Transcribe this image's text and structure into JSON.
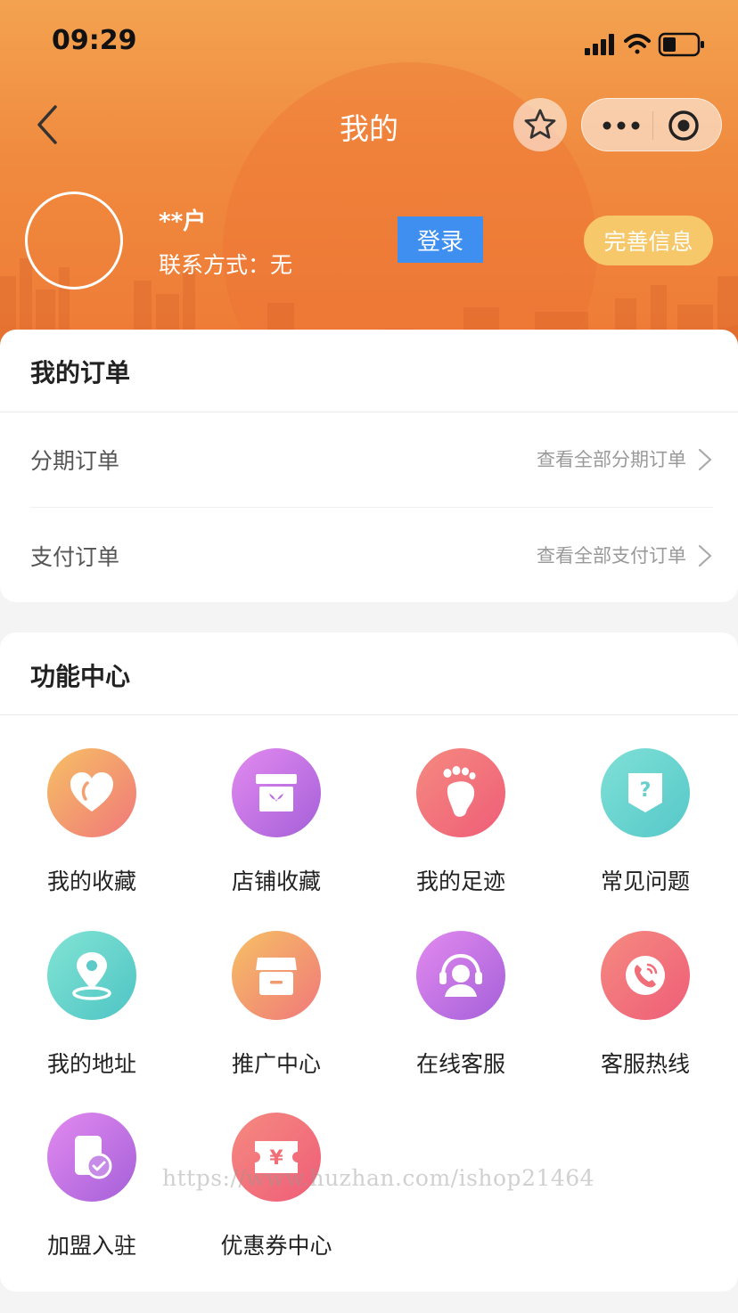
{
  "status_bar": {
    "time": "09:29",
    "icons": [
      "signal-icon",
      "wifi-icon",
      "battery-icon"
    ]
  },
  "nav": {
    "title": "我的",
    "back_icon": "chevron-left-icon",
    "star_icon": "star-icon",
    "menu_icon": "more-dots-icon",
    "close_icon": "target-icon"
  },
  "profile": {
    "name": "**户",
    "contact": "联系方式：无",
    "login_label": "登录",
    "complete_label": "完善信息"
  },
  "orders": {
    "title": "我的订单",
    "rows": [
      {
        "label": "分期订单",
        "link": "查看全部分期订单"
      },
      {
        "label": "支付订单",
        "link": "查看全部支付订单"
      }
    ]
  },
  "functions": {
    "title": "功能中心",
    "items": [
      {
        "label": "我的收藏",
        "icon": "heart-icon"
      },
      {
        "label": "店铺收藏",
        "icon": "box-icon"
      },
      {
        "label": "我的足迹",
        "icon": "footprint-icon"
      },
      {
        "label": "常见问题",
        "icon": "question-icon"
      },
      {
        "label": "我的地址",
        "icon": "location-icon"
      },
      {
        "label": "推广中心",
        "icon": "shop-icon"
      },
      {
        "label": "在线客服",
        "icon": "headset-icon"
      },
      {
        "label": "客服热线",
        "icon": "phone-icon"
      },
      {
        "label": "加盟入驻",
        "icon": "join-icon"
      },
      {
        "label": "优惠券中心",
        "icon": "coupon-icon"
      }
    ]
  },
  "colors": {
    "header_orange": "#f08a3e",
    "login_blue": "#3e8ff0",
    "complete_yellow": "#f6c86a"
  },
  "watermark": "https://www.huzhan.com/ishop21464"
}
